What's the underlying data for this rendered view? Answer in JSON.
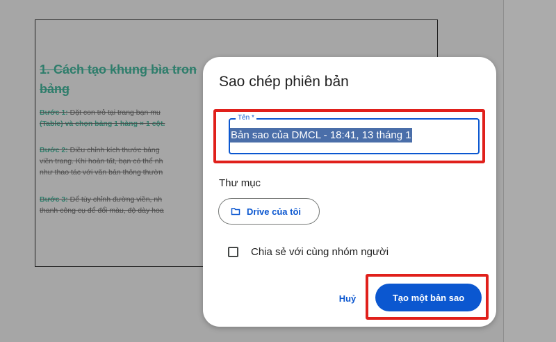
{
  "document": {
    "heading": "1. Cách tạo khung bìa tron\nbảng",
    "paragraphs": [
      {
        "step": "Bước 1:",
        "lines": [
          " Đặt con trỏ tại trang bạn mu",
          "(Table) và chọn bảng 1 hàng × 1 cột."
        ]
      },
      {
        "step": "Bước 2:",
        "lines": [
          " Điều chỉnh kích thước bảng",
          "viền trang. Khi hoàn tất, bạn có thể nh",
          "như thao tác với văn bản thông thườn"
        ]
      },
      {
        "step": "Bước 3:",
        "lines": [
          " Để tùy chỉnh đường viền, nh",
          "thanh công cụ để đổi màu, độ dày hoa"
        ]
      }
    ]
  },
  "dialog": {
    "title": "Sao chép phiên bản",
    "name_field": {
      "label": "Tên *",
      "value": "Bản sao của DMCL - 18:41, 13 tháng 1"
    },
    "folder": {
      "label": "Thư mục",
      "chip_label": "Drive của tôi",
      "icon": "folder-icon"
    },
    "share_checkbox": {
      "label": "Chia sẻ với cùng nhóm người",
      "checked": false
    },
    "cancel_label": "Huỷ",
    "create_label": "Tạo một bản sao"
  },
  "colors": {
    "accent": "#0b57d0",
    "highlight": "#e0201b",
    "heading_green": "#2e7d6b",
    "selection": "#4a6ea9"
  }
}
